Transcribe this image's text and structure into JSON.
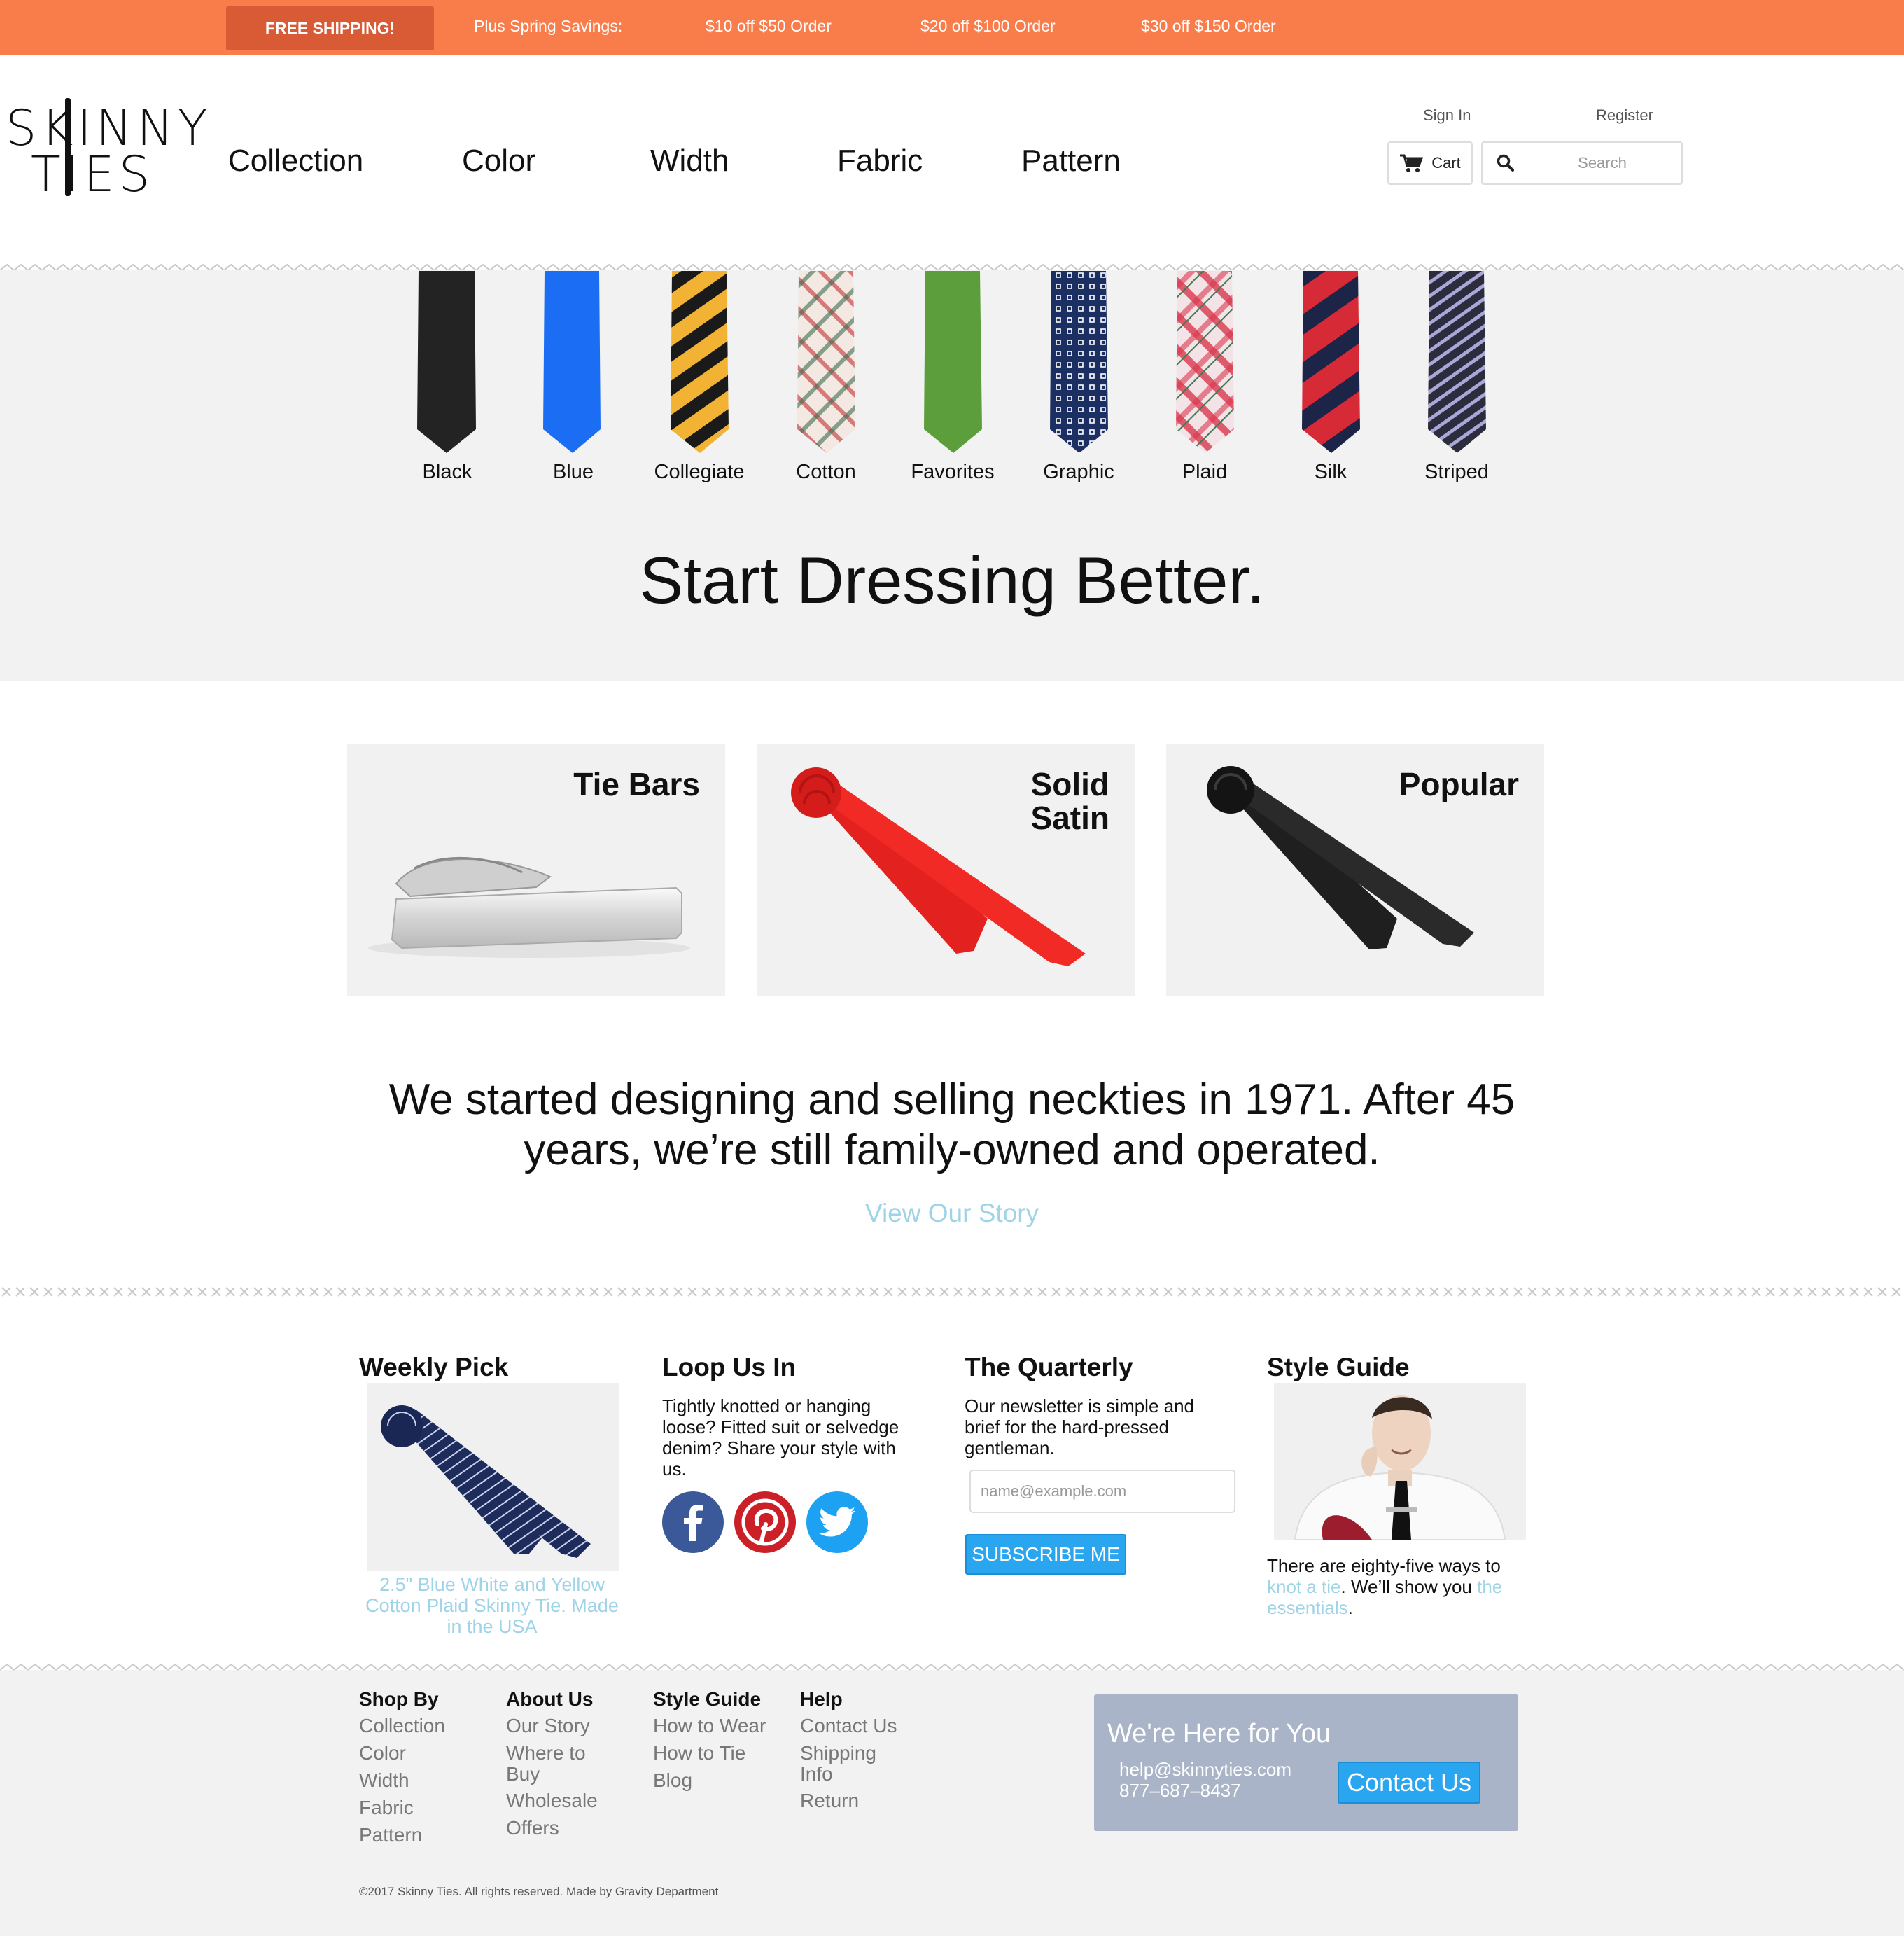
{
  "promo": {
    "badge": "FREE SHIPPING!",
    "items": [
      "Plus Spring Savings:",
      "$10 off $50 Order",
      "$20 off $100 Order",
      "$30 off $150 Order"
    ]
  },
  "brand": {
    "line1": "SKINNY",
    "line2": "TIES"
  },
  "nav": [
    "Collection",
    "Color",
    "Width",
    "Fabric",
    "Pattern"
  ],
  "account": {
    "sign_in": "Sign In",
    "register": "Register",
    "cart": "Cart",
    "search_placeholder": "Search"
  },
  "ties": [
    {
      "label": "Black",
      "color": "#222222"
    },
    {
      "label": "Blue",
      "color": "#1b6ef3"
    },
    {
      "label": "Collegiate",
      "color": "#f2b233"
    },
    {
      "label": "Cotton",
      "color": "#e8d6cc"
    },
    {
      "label": "Favorites",
      "color": "#5c9e3b"
    },
    {
      "label": "Graphic",
      "color": "#1c2f63"
    },
    {
      "label": "Plaid",
      "color": "#e04257"
    },
    {
      "label": "Silk",
      "color": "#d72a37"
    },
    {
      "label": "Striped",
      "color": "#5a5a7a"
    }
  ],
  "hero_title": "Start Dressing Better.",
  "cards": [
    {
      "title": "Tie Bars"
    },
    {
      "title_l1": "Solid",
      "title_l2": "Satin"
    },
    {
      "title": "Popular"
    }
  ],
  "story": {
    "text": "We started designing and selling neckties in 1971. After 45 years, we’re still family-owned and operated.",
    "link": "View Our Story"
  },
  "weekly_pick": {
    "title": "Weekly Pick",
    "caption": "2.5\" Blue White and Yellow Cotton Plaid Skinny Tie. Made in the USA"
  },
  "loop": {
    "title": "Loop Us In",
    "text": "Tightly knotted or hanging loose? Fitted suit or selvedge denim? Share your style with us."
  },
  "quarterly": {
    "title": "The Quarterly",
    "text": "Our newsletter is simple and brief for the hard-pressed gentleman.",
    "email_placeholder": "name@example.com",
    "button": "SUBSCRIBE ME"
  },
  "style_guide": {
    "title": "Style Guide",
    "text_a": "There are eighty-five ways to ",
    "link_a": "knot a tie",
    "text_b": ". We’ll show you ",
    "link_b": "the essentials",
    "text_c": "."
  },
  "footer": {
    "shop_by": {
      "title": "Shop By",
      "links": [
        "Collection",
        "Color",
        "Width",
        "Fabric",
        "Pattern"
      ]
    },
    "about": {
      "title": "About Us",
      "links": [
        "Our Story",
        "Where to Buy",
        "Wholesale",
        "Offers"
      ]
    },
    "style": {
      "title": "Style Guide",
      "links": [
        "How to Wear",
        "How to Tie",
        "Blog"
      ]
    },
    "help": {
      "title": "Help",
      "links": [
        "Contact Us",
        "Shipping Info",
        "Return"
      ]
    },
    "contact": {
      "title": "We're Here for You",
      "email": "help@skinnyties.com",
      "phone": "877–687–8437",
      "button": "Contact Us"
    },
    "copyright": "©2017 Skinny Ties. All rights reserved. Made by Gravity Department"
  },
  "colors": {
    "accent": "#f97d4b",
    "link": "#9fd3e8",
    "button": "#2aa6f1",
    "help_box": "#aab4c8"
  }
}
